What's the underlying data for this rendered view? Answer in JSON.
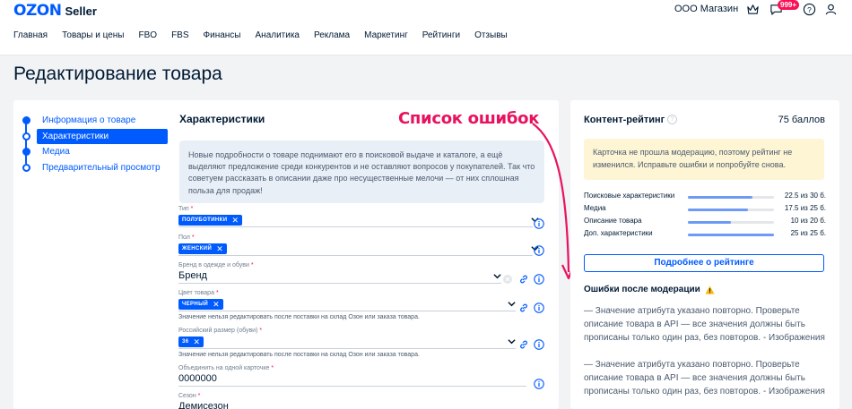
{
  "header": {
    "logo_main": "OZON",
    "logo_sub": "Seller",
    "shop_name": "ООО Магазин",
    "notifications_badge": "999+"
  },
  "nav": [
    "Главная",
    "Товары и цены",
    "FBO",
    "FBS",
    "Финансы",
    "Аналитика",
    "Реклама",
    "Маркетинг",
    "Рейтинги",
    "Отзывы"
  ],
  "page_title": "Редактирование товара",
  "steps": [
    {
      "label": "Информация о товаре",
      "state": "done"
    },
    {
      "label": "Характеристики",
      "state": "active"
    },
    {
      "label": "Медиа",
      "state": "done"
    },
    {
      "label": "Предварительный просмотр",
      "state": "todo"
    }
  ],
  "section_title": "Характеристики",
  "info_text": "Новые подробности о товаре поднимают его в поисковой выдаче и каталоге, а ещё выделяют предложение среди конкурентов и не оставляют вопросов у покупателей. Так что советуем рассказать в описании даже про несущественные мелочи — от них сплошная польза для продаж!",
  "fields": [
    {
      "label": "Тип",
      "chip": "ПОЛУБОТИНКИ"
    },
    {
      "label": "Пол",
      "chip": "ЖЕНСКИЙ"
    },
    {
      "label": "Бренд в одежде и обуви",
      "value": "Бренд"
    },
    {
      "label": "Цвет товара",
      "chip": "ЧЕРНЫЙ",
      "help": "Значение нельзя редактировать после поставки на склад Озон или заказа товара."
    },
    {
      "label": "Российский размер (обуви)",
      "chip": "36",
      "help": "Значение нельзя редактировать после поставки на склад Озон или заказа товара."
    },
    {
      "label": "Объединить на одной карточке",
      "value": "0000000"
    },
    {
      "label": "Сезон",
      "value": "Демисезон"
    }
  ],
  "annotation": "Список ошибок",
  "content_rating": {
    "title": "Контент-рейтинг",
    "help_icon": "?",
    "score": "75 баллов",
    "notice": "Карточка не прошла модерацию, поэтому рейтинг не изменился. Исправьте ошибки и попробуйте снова.",
    "metrics": [
      {
        "name": "Поисковые характеристики",
        "value": "22.5 из 30 б.",
        "fraction": 0.75
      },
      {
        "name": "Медиа",
        "value": "17.5 из 25 б.",
        "fraction": 0.7
      },
      {
        "name": "Описание товара",
        "value": "10 из 20 б.",
        "fraction": 0.5
      },
      {
        "name": "Доп. характеристики",
        "value": "25 из 25 б.",
        "fraction": 1.0
      }
    ],
    "more_button": "Подробнее о рейтинге"
  },
  "errors": {
    "title": "Ошибки после модерации",
    "items": [
      "— Значение атрибута указано повторно. Проверьте описание товара в API — все значения должны быть прописаны только один раз, без повторов. - Изображения",
      "— Значение атрибута указано повторно. Проверьте описание товара в API — все значения должны быть прописаны только один раз, без повторов. - Изображения"
    ]
  },
  "colors": {
    "accent": "#005bff",
    "annotation": "#e8125f",
    "warning_bg": "#fdf5d3",
    "info_bg": "#e9eff7"
  }
}
